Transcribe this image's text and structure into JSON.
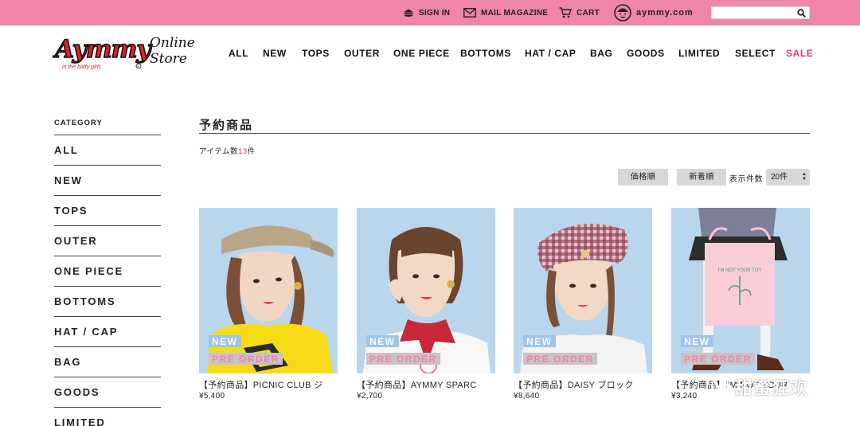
{
  "topbar": {
    "signin": "SIGN IN",
    "mail": "MAIL MAGAZINE",
    "cart": "CART",
    "site": "aymmy.com",
    "search_placeholder": ""
  },
  "logo": {
    "brand": "Aymmy",
    "tagline": "in the batty girls",
    "store": "Online Store"
  },
  "nav": [
    "ALL",
    "NEW",
    "TOPS",
    "OUTER",
    "ONE PIECE",
    "BOTTOMS",
    "HAT / CAP",
    "BAG",
    "GOODS",
    "LIMITED",
    "SELECT",
    "SALE"
  ],
  "sidebar": {
    "title": "CATEGORY",
    "items": [
      "ALL",
      "NEW",
      "TOPS",
      "OUTER",
      "ONE PIECE",
      "BOTTOMS",
      "HAT / CAP",
      "BAG",
      "GOODS",
      "LIMITED"
    ]
  },
  "main": {
    "title": "予約商品",
    "count_prefix": "アイテム数",
    "count_value": "13",
    "count_suffix": "件",
    "sort_price": "価格順",
    "sort_new": "新着順",
    "per_page_label": "表示件数",
    "per_page_value": "20件"
  },
  "badges": {
    "new": "NEW",
    "pre_order": "PRE ORDER"
  },
  "products": [
    {
      "name": "【予約商品】PICNIC CLUB ジ",
      "price": "¥5,400"
    },
    {
      "name": "【予約商品】AYMMY SPARC",
      "price": "¥2,700"
    },
    {
      "name": "【予約商品】DAISY ブロック",
      "price": "¥8,640"
    },
    {
      "name": "【予約商品】I'M NOT YOUR",
      "price": "¥3,240"
    }
  ],
  "watermark": "甜蜜狂欢",
  "colors": {
    "pink": "#ef85a7",
    "sale": "#e2376b",
    "logo_red": "#e51e2a",
    "badge_new": "#9ec4ec"
  }
}
